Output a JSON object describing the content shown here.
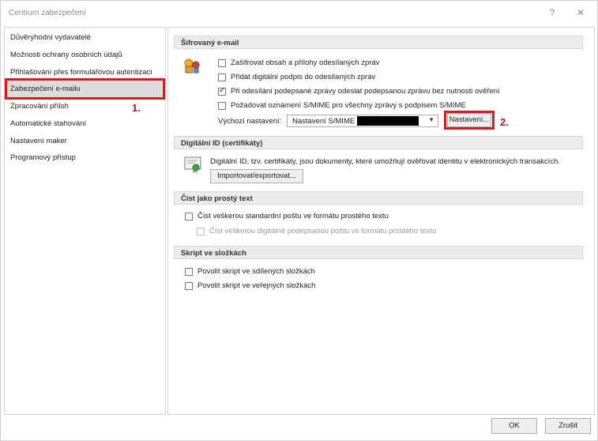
{
  "window": {
    "title": "Centrum zabezpečení",
    "help_label": "?",
    "close_label": "✕"
  },
  "nav": {
    "items": [
      {
        "label": "Důvěryhodní vydavatelé"
      },
      {
        "label": "Možnosti ochrany osobních údajů"
      },
      {
        "label": "Přihlašování přes formulářovou autentizaci"
      },
      {
        "label": "Zabezpečení e-mailu",
        "selected": true
      },
      {
        "label": "Zpracování příloh"
      },
      {
        "label": "Automatické stahování"
      },
      {
        "label": "Nastavení maker"
      },
      {
        "label": "Programový přístup"
      }
    ]
  },
  "annotations": {
    "step1": "1.",
    "step2": "2."
  },
  "encrypted_email": {
    "heading": "Šifrovaný e-mail",
    "options": [
      {
        "label": "Zašifrovat obsah a přílohy odesílaných zpráv",
        "checked": false
      },
      {
        "label": "Přidat digitální podpis do odesílaných zpráv",
        "checked": false
      },
      {
        "label": "Při odesílání podepsané zprávy odeslat podepsanou zprávu bez nutnosti ověření",
        "checked": true
      },
      {
        "label": "Požadovat oznámení S/MIME pro všechny zprávy s podpisem S/MIME",
        "checked": false
      }
    ],
    "default_settings_label": "Výchozí nastavení:",
    "default_settings_value": "Nastavení S/MIME",
    "settings_button": "Nastavení..."
  },
  "digital_id": {
    "heading": "Digitální ID (certifikáty)",
    "description": "Digitální ID, tzv. certifikáty, jsou dokumenty, které umožňují ověřovat identitu v elektronických transakcích.",
    "import_export_button": "Importovat/exportovat..."
  },
  "plain_text": {
    "heading": "Číst jako prostý text",
    "options": [
      {
        "label": "Číst veškerou standardní poštu ve formátu prostého textu",
        "checked": false,
        "enabled": true
      },
      {
        "label": "Číst veškerou digitálně podepsanou poštu ve formátu prostého textu",
        "checked": false,
        "enabled": false
      }
    ]
  },
  "folder_script": {
    "heading": "Skript ve složkách",
    "options": [
      {
        "label": "Povolit skript ve sdílených složkách",
        "checked": false
      },
      {
        "label": "Povolit skript ve veřejných složkách",
        "checked": false
      }
    ]
  },
  "footer": {
    "ok": "OK",
    "cancel": "Zrušit"
  },
  "colors": {
    "highlight_red": "#cc1f26",
    "selected_bg": "#dcdcdc",
    "section_bg": "#ececec"
  }
}
